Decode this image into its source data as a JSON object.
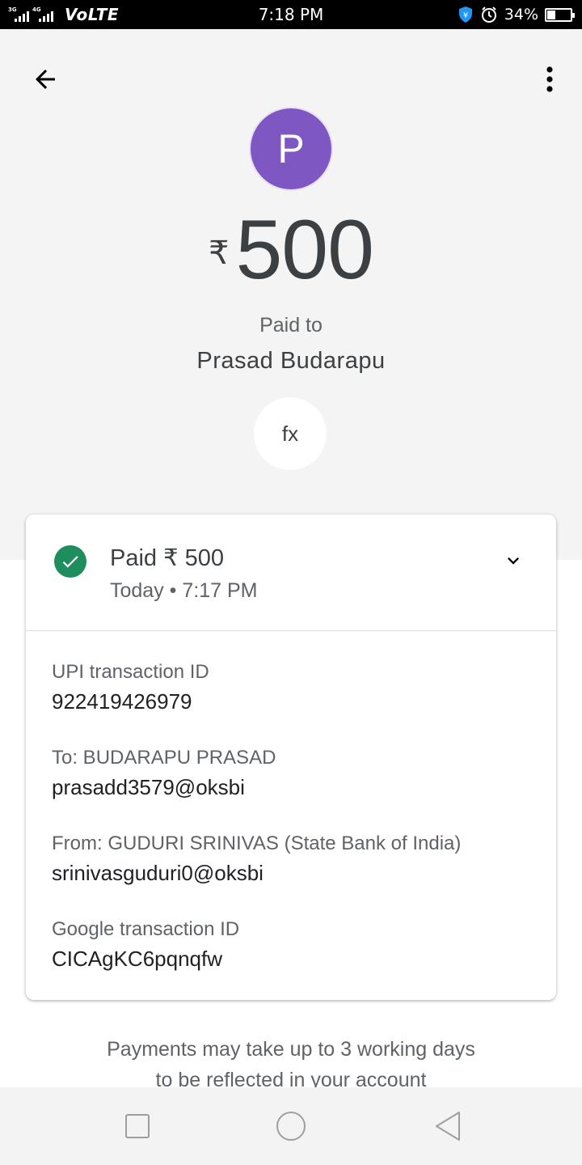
{
  "status_bar": {
    "network_1": "3G",
    "network_2": "4G",
    "volte": "VoLTE",
    "time": "7:18 PM",
    "battery_percent": "34%",
    "battery_level": 0.34,
    "icons": [
      "signal-icon",
      "shield-icon",
      "alarm-icon",
      "battery-icon"
    ]
  },
  "header": {
    "back_icon": "arrow-back-icon",
    "more_icon": "more-vert-icon",
    "avatar_letter": "P",
    "avatar_color": "#7e57c2",
    "currency_symbol": "₹",
    "amount": "500",
    "paid_to_label": "Paid to",
    "payee_name": "Prasad Budarapu",
    "fx_label": "fx"
  },
  "card": {
    "status_icon": "check-circle-icon",
    "status_color": "#1e8e5e",
    "paid_title": "Paid ₹ 500",
    "paid_time": "Today • 7:17 PM",
    "expand_icon": "chevron-down-icon",
    "details": [
      {
        "label": "UPI transaction ID",
        "value": "922419426979"
      },
      {
        "label": "To: BUDARAPU  PRASAD",
        "value": "prasadd3579@oksbi"
      },
      {
        "label": "From: GUDURI  SRINIVAS (State Bank of India)",
        "value": "srinivasguduri0@oksbi"
      },
      {
        "label": "Google transaction ID",
        "value": "CICAgKC6pqnqfw"
      }
    ]
  },
  "note": {
    "line1": "Payments may take up to 3 working days",
    "line2": "to be reflected in your account"
  },
  "nav": {
    "recents_icon": "square-icon",
    "home_icon": "circle-icon",
    "back_icon": "triangle-back-icon"
  }
}
